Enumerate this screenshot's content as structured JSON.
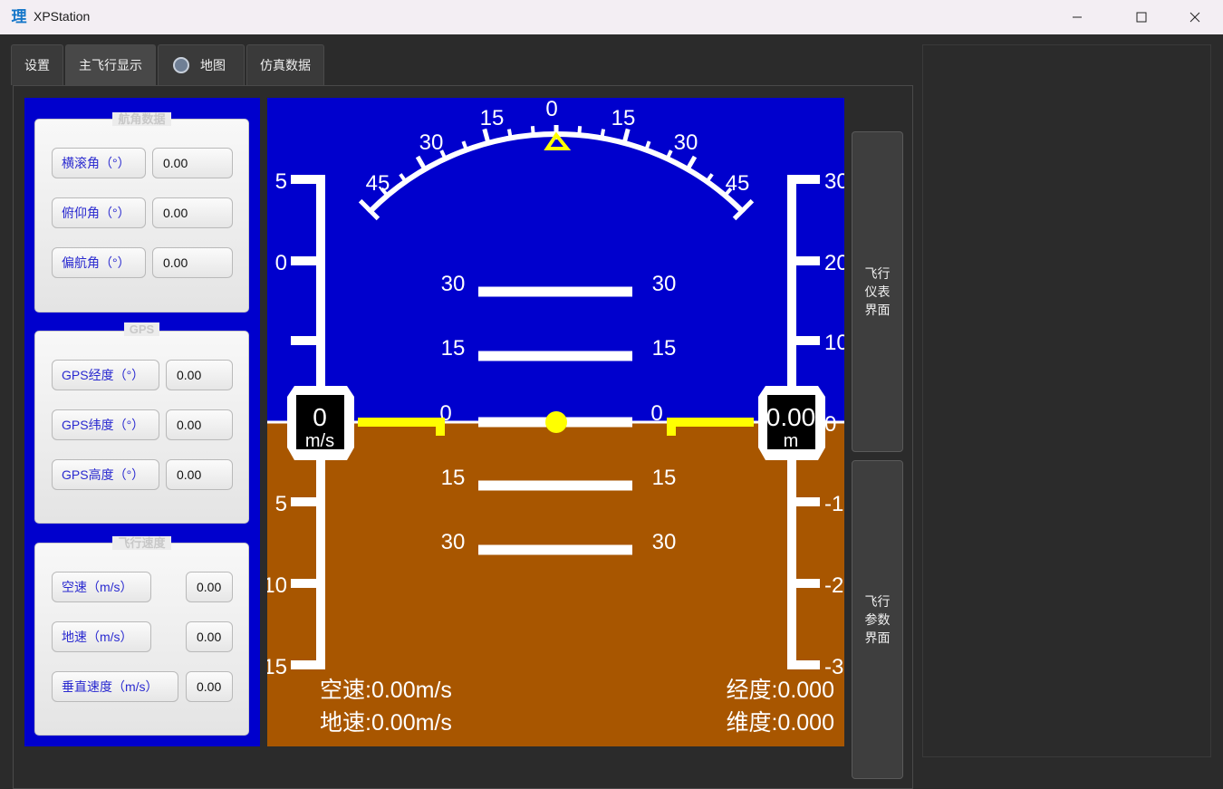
{
  "window": {
    "title": "XPStation",
    "app_icon_char": "理"
  },
  "tabs": [
    {
      "label": "设置"
    },
    {
      "label": "主飞行显示"
    },
    {
      "label": "地图",
      "icon": "map-icon"
    },
    {
      "label": "仿真数据"
    }
  ],
  "active_tab": "主飞行显示",
  "attitude_group": {
    "title": "航角数据",
    "rows": [
      {
        "label": "横滚角（°）",
        "value": "0.00"
      },
      {
        "label": "俯仰角（°）",
        "value": "0.00"
      },
      {
        "label": "偏航角（°）",
        "value": "0.00"
      }
    ]
  },
  "gps_group": {
    "title": "GPS",
    "rows": [
      {
        "label": "GPS经度（°）",
        "value": "0.00"
      },
      {
        "label": "GPS纬度（°）",
        "value": "0.00"
      },
      {
        "label": "GPS高度（°）",
        "value": "0.00"
      }
    ]
  },
  "speed_group": {
    "title": "飞行速度",
    "rows": [
      {
        "label": "空速（m/s）",
        "value": "0.00"
      },
      {
        "label": "地速（m/s）",
        "value": "0.00"
      },
      {
        "label": "垂直速度（m/s）",
        "value": "0.00"
      }
    ]
  },
  "pfd": {
    "colors": {
      "sky": "#0000cd",
      "ground": "#a85600",
      "marker": "#ffff00",
      "scale": "#ffffff"
    },
    "roll_labels": [
      "45",
      "30",
      "15",
      "0",
      "15",
      "30",
      "45"
    ],
    "pitch_labels": [
      "30",
      "15",
      "0",
      "15",
      "30"
    ],
    "speed_tape_labels": [
      "5",
      "0",
      "",
      "",
      "5",
      "10",
      "15"
    ],
    "alt_tape_labels": [
      "30",
      "20",
      "10",
      "0",
      "-1",
      "-2",
      "-3"
    ],
    "speed_readout": {
      "value": "0",
      "unit": "m/s"
    },
    "alt_readout": {
      "value": "0.00",
      "unit": "m"
    },
    "airspeed_text": "空速:0.00m/s",
    "groundspeed_text": "地速:0.00m/s",
    "longitude_text": "经度:0.000",
    "latitude_text": "维度:0.000"
  },
  "side_buttons": [
    {
      "label": "飞行\n仪表\n界面"
    },
    {
      "label": "飞行\n参数\n界面"
    }
  ]
}
